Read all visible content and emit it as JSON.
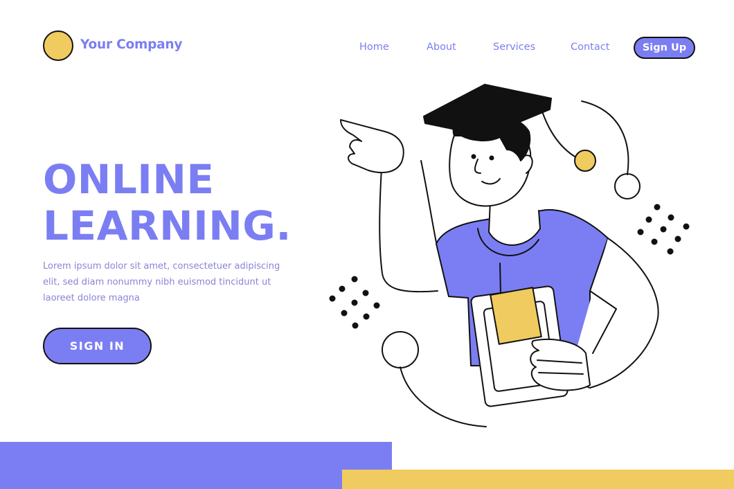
{
  "header": {
    "company_name": "Your Company",
    "nav": [
      {
        "label": "Home"
      },
      {
        "label": "About"
      },
      {
        "label": "Services"
      },
      {
        "label": "Contact"
      }
    ],
    "signup_label": "Sign Up"
  },
  "hero": {
    "title_line1": "ONLINE",
    "title_line2": "LEARNING.",
    "description": "Lorem ipsum dolor sit amet, consectetuer adipiscing elit, sed diam nonummy nibh euismod tincidunt ut laoreet dolore magna",
    "signin_label": "SIGN IN"
  },
  "colors": {
    "accent_purple": "#7b7ef2",
    "accent_yellow": "#f0cb5f",
    "outline": "#111111",
    "background": "#ffffff"
  },
  "icons": {
    "logo": "yellow-circle-logo",
    "illustration": "graduate-student-pointing"
  }
}
